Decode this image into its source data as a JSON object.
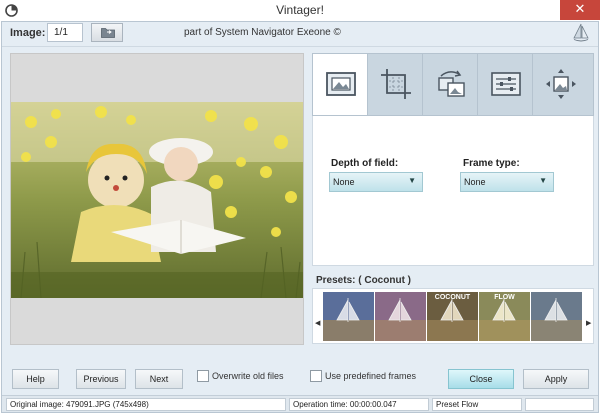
{
  "window": {
    "title": "Vintager!",
    "close_symbol": "✕"
  },
  "toolbar": {
    "image_label": "Image:",
    "image_value": "1/1",
    "credit": "part of System Navigator Exeone ©"
  },
  "tools": [
    {
      "name": "frame-tool",
      "icon": "frame-icon",
      "active": true
    },
    {
      "name": "crop-tool",
      "icon": "crop-icon",
      "active": false
    },
    {
      "name": "rotate-tool",
      "icon": "rotate-icon",
      "active": false
    },
    {
      "name": "adjust-tool",
      "icon": "sliders-icon",
      "active": false
    },
    {
      "name": "resize-tool",
      "icon": "resize-icon",
      "active": false
    }
  ],
  "options": {
    "depth_label": "Depth of field:",
    "depth_value": "None",
    "frame_label": "Frame type:",
    "frame_value": "None"
  },
  "presets": {
    "label": "Presets: ( Coconut )",
    "items": [
      {
        "label": ""
      },
      {
        "label": ""
      },
      {
        "label": "COCONUT"
      },
      {
        "label": "FLOW"
      },
      {
        "label": ""
      }
    ]
  },
  "buttons": {
    "help": "Help",
    "previous": "Previous",
    "next": "Next",
    "close": "Close",
    "apply": "Apply"
  },
  "checkboxes": {
    "overwrite": "Overwrite old files",
    "predefined": "Use predefined frames"
  },
  "status": {
    "original": "Original image: 479091.JPG (745x498)",
    "operation": "Operation time: 00:00:00.047",
    "preset": "Preset Flow",
    "extra": ""
  },
  "colors": {
    "accent": "#a7dde8",
    "frame_bg": "#e5edf4",
    "close_red": "#c7463b"
  }
}
